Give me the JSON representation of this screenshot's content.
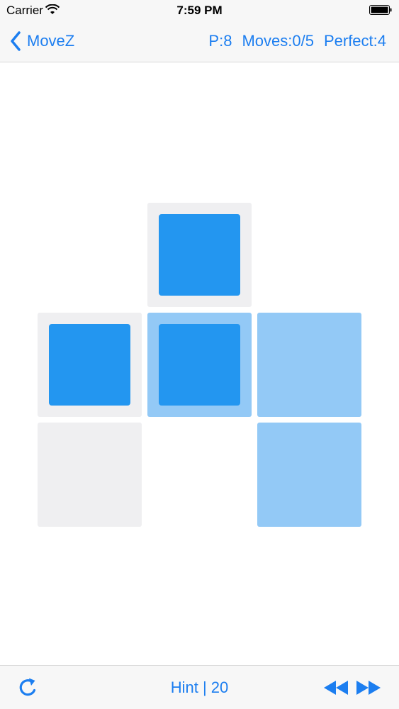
{
  "status_bar": {
    "carrier": "Carrier",
    "time": "7:59 PM",
    "wifi_icon": "wifi-icon",
    "battery_icon": "battery-icon"
  },
  "nav": {
    "back_label": "MoveZ",
    "back_icon": "chevron-left-icon",
    "points": "P:8",
    "moves": "Moves:0/5",
    "perfect": "Perfect:4"
  },
  "board": {
    "rows": 3,
    "cols": 3,
    "cells": [
      {
        "row": 0,
        "col": 1,
        "kind": "target",
        "block": true
      },
      {
        "row": 1,
        "col": 0,
        "kind": "target",
        "block": true
      },
      {
        "row": 1,
        "col": 1,
        "kind": "highlighted",
        "block": true
      },
      {
        "row": 1,
        "col": 2,
        "kind": "highlighted",
        "block": false
      },
      {
        "row": 2,
        "col": 0,
        "kind": "target",
        "block": false
      },
      {
        "row": 2,
        "col": 2,
        "kind": "highlighted",
        "block": false
      }
    ]
  },
  "toolbar": {
    "restart_icon": "restart-icon",
    "hint_label": "Hint",
    "hint_separator": "|",
    "hint_count": "20",
    "rewind_icon": "rewind-icon",
    "fast_forward_icon": "fast-forward-icon"
  },
  "colors": {
    "accent": "#1c7ef0",
    "block": "#2396f0",
    "highlight": "#93c9f6",
    "target": "#efeff1"
  }
}
